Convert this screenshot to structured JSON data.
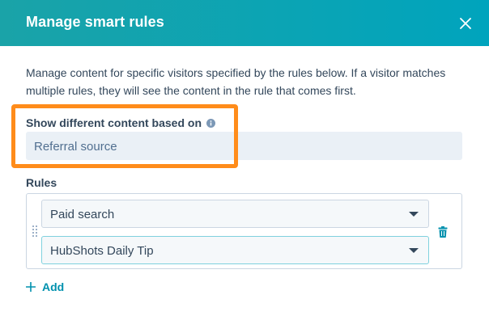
{
  "modal": {
    "title": "Manage smart rules",
    "description": "Manage content for specific visitors specified by the rules below. If a visitor matches multiple rules, they will see the content in the rule that comes first."
  },
  "source": {
    "label": "Show different content based on",
    "value": "Referral source"
  },
  "rules": {
    "label": "Rules",
    "items": [
      {
        "condition": "Paid search",
        "content": "HubShots Daily Tip"
      }
    ],
    "add_label": "Add"
  },
  "colors": {
    "header": "#00a4bd",
    "highlight": "#ff8c1a",
    "link": "#0091ae"
  },
  "icons": [
    "close-icon",
    "info-icon",
    "drag-handle-icon",
    "chevron-down-icon",
    "trash-icon",
    "plus-icon"
  ]
}
